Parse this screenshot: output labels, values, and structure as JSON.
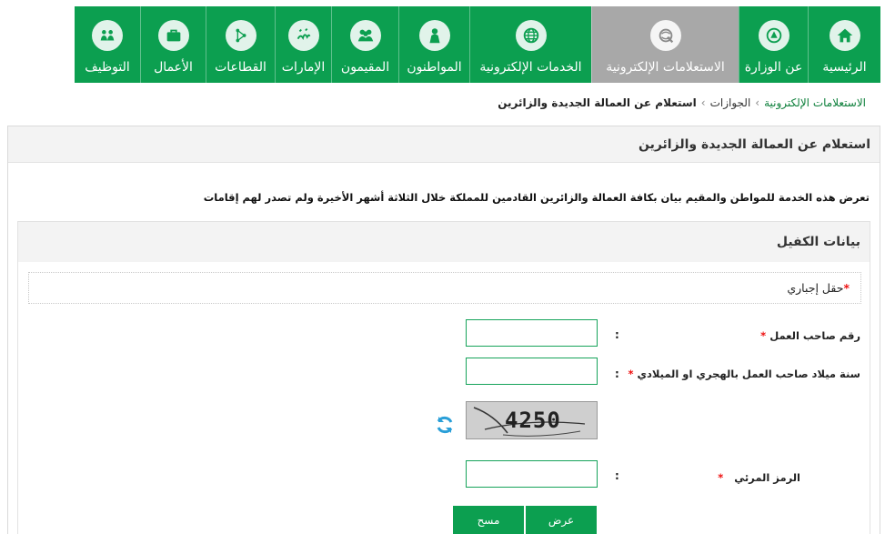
{
  "nav": {
    "items": [
      {
        "label": "الرئيسية",
        "icon": "home-icon"
      },
      {
        "label": "عن الوزارة",
        "icon": "emblem-icon"
      },
      {
        "label": "الاستعلامات الإلكترونية",
        "icon": "inquiry-icon",
        "active": true
      },
      {
        "label": "الخدمات الإلكترونية",
        "icon": "globe-icon"
      },
      {
        "label": "المواطنون",
        "icon": "citizen-icon"
      },
      {
        "label": "المقيمون",
        "icon": "residents-icon"
      },
      {
        "label": "الإمارات",
        "icon": "calligraphy-icon"
      },
      {
        "label": "القطاعات",
        "icon": "network-icon"
      },
      {
        "label": "الأعمال",
        "icon": "briefcase-icon"
      },
      {
        "label": "التوظيف",
        "icon": "people-icon"
      }
    ]
  },
  "breadcrumb": {
    "root": "الاستعلامات الإلكترونية",
    "parent": "الجوازات",
    "current": "استعلام عن العمالة الجديدة والزائرين"
  },
  "page": {
    "title": "استعلام عن العمالة الجديدة والزائرين",
    "intro": "تعرض هذه الخدمة للمواطن والمقيم بيان بكافة العمالة والزائرين القادمين للمملكة خلال الثلاثة أشهر الأخيرة ولم تصدر لهم إقامات"
  },
  "section": {
    "title": "بيانات الكفيل",
    "required_note": "حقل إجباري",
    "required_mark": "*"
  },
  "form": {
    "colon": ":",
    "employer_number_label": "رقم صاحب العمل",
    "employer_number_value": "",
    "birth_year_label": "سنة ميلاد صاحب العمل بالهجري او الميلادي",
    "birth_year_value": "",
    "captcha_text": "4250",
    "captcha_code_label": "الرمز المرئي",
    "captcha_code_value": ""
  },
  "buttons": {
    "submit": "عرض",
    "clear": "مسح"
  },
  "colors": {
    "brand_green": "#0c9f50",
    "active_tab": "#a8a8a8",
    "required_red": "#e11111"
  }
}
